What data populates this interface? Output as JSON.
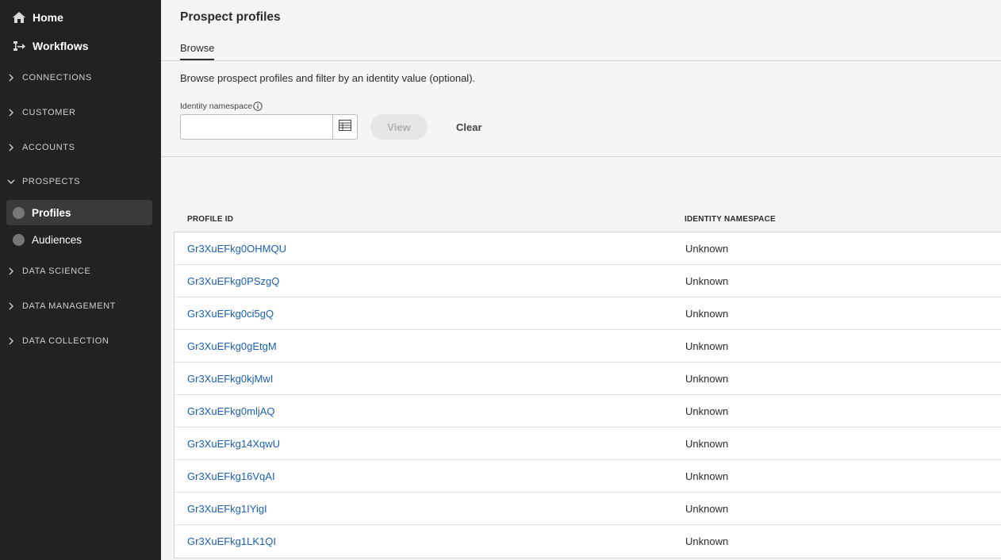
{
  "sidebar": {
    "top": [
      {
        "label": "Home",
        "icon": "home-icon"
      },
      {
        "label": "Workflows",
        "icon": "workflow-icon"
      }
    ],
    "sections": [
      {
        "label": "CONNECTIONS"
      },
      {
        "label": "CUSTOMER"
      },
      {
        "label": "ACCOUNTS"
      },
      {
        "label": "PROSPECTS"
      },
      {
        "label": "DATA SCIENCE"
      },
      {
        "label": "DATA MANAGEMENT"
      },
      {
        "label": "DATA COLLECTION"
      }
    ],
    "prospects_items": [
      {
        "label": "Profiles",
        "active": true
      },
      {
        "label": "Audiences",
        "active": false
      }
    ]
  },
  "header": {
    "title": "Prospect profiles",
    "tabs": [
      {
        "label": "Browse"
      }
    ]
  },
  "filter": {
    "description": "Browse prospect profiles and filter by an identity value (optional).",
    "namespace_label": "Identity namespace",
    "namespace_value": "",
    "view_label": "View",
    "clear_label": "Clear"
  },
  "table": {
    "columns": [
      "PROFILE ID",
      "IDENTITY NAMESPACE"
    ],
    "rows": [
      {
        "id": "Gr3XuEFkg0OHMQU",
        "namespace": "Unknown"
      },
      {
        "id": "Gr3XuEFkg0PSzgQ",
        "namespace": "Unknown"
      },
      {
        "id": "Gr3XuEFkg0ci5gQ",
        "namespace": "Unknown"
      },
      {
        "id": "Gr3XuEFkg0gEtgM",
        "namespace": "Unknown"
      },
      {
        "id": "Gr3XuEFkg0kjMwI",
        "namespace": "Unknown"
      },
      {
        "id": "Gr3XuEFkg0mljAQ",
        "namespace": "Unknown"
      },
      {
        "id": "Gr3XuEFkg14XqwU",
        "namespace": "Unknown"
      },
      {
        "id": "Gr3XuEFkg16VqAI",
        "namespace": "Unknown"
      },
      {
        "id": "Gr3XuEFkg1IYigI",
        "namespace": "Unknown"
      },
      {
        "id": "Gr3XuEFkg1LK1QI",
        "namespace": "Unknown"
      }
    ]
  },
  "colors": {
    "sidebar_bg": "#222222",
    "link": "#1a5fb4",
    "active_item_bg": "#3a3a3a"
  }
}
